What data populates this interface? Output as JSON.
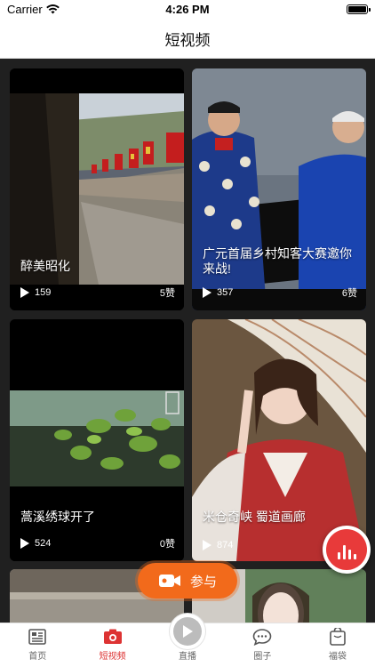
{
  "status_bar": {
    "carrier": "Carrier",
    "time": "4:26 PM"
  },
  "header": {
    "title": "短视频"
  },
  "videos": [
    {
      "title": "醉美昭化",
      "views": "159",
      "likes": "5赞",
      "thumb_icon": "great-wall-photo"
    },
    {
      "title": "广元首届乡村知客大赛邀你来战!",
      "views": "357",
      "likes": "6赞",
      "thumb_icon": "two-men-in-blue-robes-photo"
    },
    {
      "title": "蒿溪绣球开了",
      "views": "524",
      "likes": "0赞",
      "thumb_icon": "green-leaves-photo"
    },
    {
      "title": "米仓奇峡 蜀道画廊",
      "views": "874",
      "likes": "",
      "thumb_icon": "woman-with-umbrella-photo"
    }
  ],
  "join_button": {
    "label": "参与",
    "icon": "video-camera-icon"
  },
  "fab": {
    "icon": "bar-chart-icon"
  },
  "tabbar": {
    "items": [
      {
        "label": "首页",
        "icon": "home-newspaper-icon"
      },
      {
        "label": "短视频",
        "icon": "camera-icon",
        "active": true
      },
      {
        "label": "直播",
        "icon": "play-circle-icon"
      },
      {
        "label": "圈子",
        "icon": "chat-bubble-icon"
      },
      {
        "label": "福袋",
        "icon": "bag-icon"
      }
    ]
  },
  "colors": {
    "accent": "#e83a3a",
    "join": "#f26a1b",
    "background": "#202020"
  }
}
